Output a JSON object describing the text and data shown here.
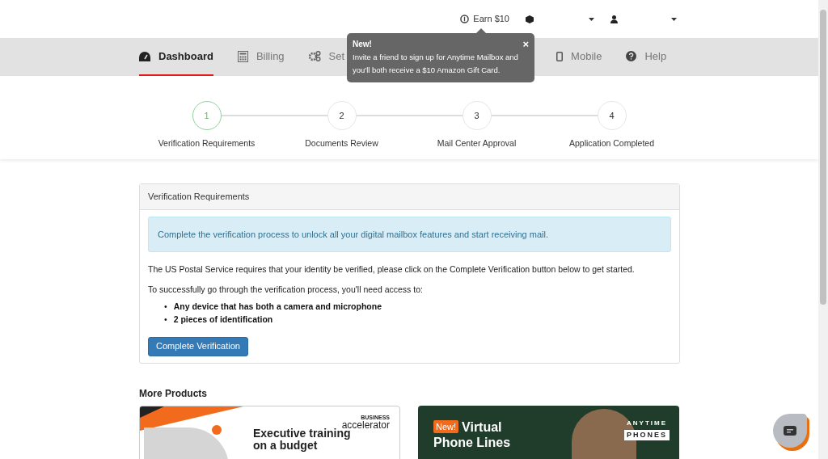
{
  "top_bar": {
    "earn": "Earn $10"
  },
  "tooltip": {
    "title": "New!",
    "close": "×",
    "text": "Invite a friend to sign up for Anytime Mailbox and you'll both receive a $10 Amazon Gift Card."
  },
  "nav": [
    {
      "label": "Dashboard",
      "kind": "gauge",
      "selected": true
    },
    {
      "label": "Billing",
      "kind": "calculator",
      "selected": false
    },
    {
      "label": "Set",
      "kind": "gears",
      "selected": false
    },
    {
      "label": "Mobile",
      "kind": "phone",
      "selected": false
    },
    {
      "label": "Help",
      "kind": "help",
      "selected": false
    }
  ],
  "steps": [
    {
      "number": "1",
      "label": "Verification Requirements",
      "current": true
    },
    {
      "number": "2",
      "label": "Documents Review",
      "current": false
    },
    {
      "number": "3",
      "label": "Mail Center Approval",
      "current": false
    },
    {
      "number": "4",
      "label": "Application Completed",
      "current": false
    }
  ],
  "card": {
    "title": "Verification Requirements",
    "alert": "Complete the verification process to unlock all your digital mailbox features and start receiving mail.",
    "paragraphs": [
      "The US Postal Service requires that your identity be verified, please click on the Complete Verification button below to get started.",
      "To successfully go through the verification process, you'll need access to:"
    ],
    "requirements": [
      {
        "marker": "•",
        "text": "Any device that has both a camera and microphone"
      },
      {
        "marker": "•",
        "text": "2 pieces of identification"
      }
    ],
    "button": "Complete Verification"
  },
  "more_products": {
    "title": "More Products",
    "banners": [
      {
        "kind": "training",
        "brand_top": "BUSINESS",
        "brand": "accelerator",
        "headline": "Executive training on a budget"
      },
      {
        "kind": "phones",
        "badge": "New!",
        "headline_lines": [
          "Virtual",
          "Phone Lines"
        ],
        "brand_top": "ANYTIME",
        "brand": "PHONES"
      }
    ]
  }
}
